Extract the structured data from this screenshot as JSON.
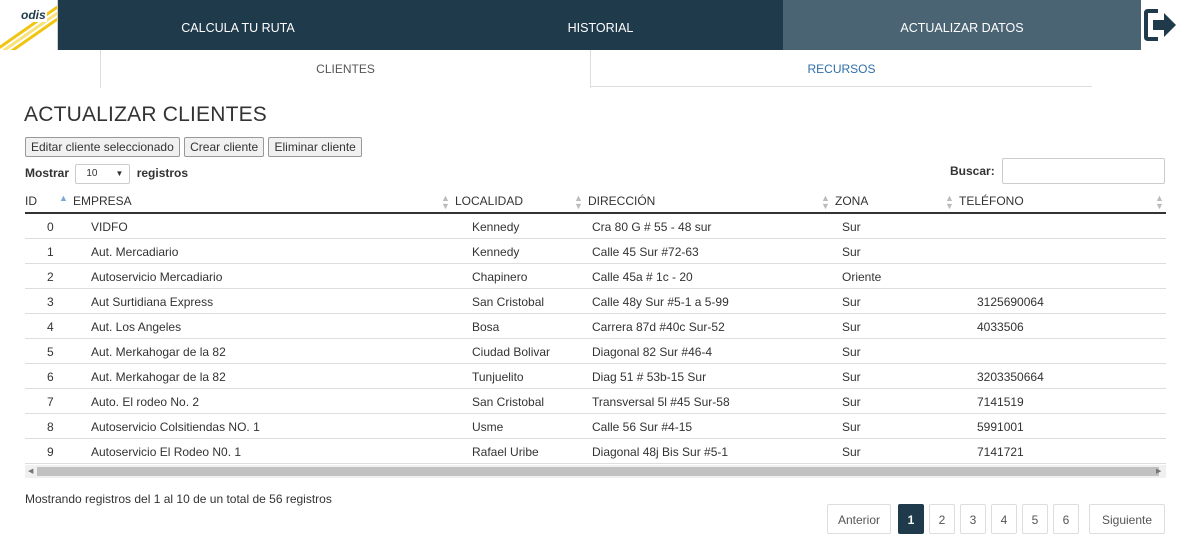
{
  "nav": {
    "logo_text": "odis",
    "items": [
      {
        "label": "CALCULA TU RUTA"
      },
      {
        "label": "HISTORIAL"
      },
      {
        "label": "ACTUALIZAR DATOS"
      }
    ],
    "exit_icon": "exit-icon"
  },
  "tabs": [
    {
      "label": "CLIENTES"
    },
    {
      "label": "RECURSOS"
    }
  ],
  "page_title": "ACTUALIZAR CLIENTES",
  "actions": {
    "edit_label": "Editar cliente seleccionado",
    "create_label": "Crear cliente",
    "delete_label": "Eliminar cliente"
  },
  "length_menu": {
    "prefix": "Mostrar",
    "value": "10",
    "suffix": "registros"
  },
  "search": {
    "label": "Buscar:",
    "value": ""
  },
  "table": {
    "columns": [
      "ID",
      "EMPRESA",
      "LOCALIDAD",
      "DIRECCIÓN",
      "ZONA",
      "TELÉFONO"
    ],
    "rows": [
      {
        "id": "0",
        "empresa": "VIDFO",
        "localidad": "Kennedy",
        "direccion": "Cra 80 G # 55 - 48 sur",
        "zona": "Sur",
        "telefono": ""
      },
      {
        "id": "1",
        "empresa": "Aut. Mercadiario",
        "localidad": "Kennedy",
        "direccion": "Calle 45 Sur #72-63",
        "zona": "Sur",
        "telefono": ""
      },
      {
        "id": "2",
        "empresa": "Autoservicio Mercadiario",
        "localidad": "Chapinero",
        "direccion": "Calle 45a # 1c - 20",
        "zona": "Oriente",
        "telefono": ""
      },
      {
        "id": "3",
        "empresa": "Aut Surtidiana Express",
        "localidad": "San Cristobal",
        "direccion": "Calle 48y Sur #5-1 a 5-99",
        "zona": "Sur",
        "telefono": "3125690064"
      },
      {
        "id": "4",
        "empresa": "Aut. Los Angeles",
        "localidad": "Bosa",
        "direccion": "Carrera 87d #40c Sur-52",
        "zona": "Sur",
        "telefono": "4033506"
      },
      {
        "id": "5",
        "empresa": "Aut. Merkahogar de la 82",
        "localidad": "Ciudad Bolivar",
        "direccion": "Diagonal 82 Sur #46-4",
        "zona": "Sur",
        "telefono": ""
      },
      {
        "id": "6",
        "empresa": "Aut. Merkahogar de la 82",
        "localidad": "Tunjuelito",
        "direccion": "Diag 51 # 53b-15 Sur",
        "zona": "Sur",
        "telefono": "3203350664"
      },
      {
        "id": "7",
        "empresa": "Auto. El rodeo No. 2",
        "localidad": "San Cristobal",
        "direccion": "Transversal 5l #45 Sur-58",
        "zona": "Sur",
        "telefono": "7141519"
      },
      {
        "id": "8",
        "empresa": "Autoservicio Colsitiendas NO. 1",
        "localidad": "Usme",
        "direccion": "Calle 56 Sur #4-15",
        "zona": "Sur",
        "telefono": "5991001"
      },
      {
        "id": "9",
        "empresa": "Autoservicio El Rodeo N0. 1",
        "localidad": "Rafael Uribe",
        "direccion": "Diagonal 48j Bis Sur #5-1",
        "zona": "Sur",
        "telefono": "7141721"
      }
    ]
  },
  "info_text": "Mostrando registros del 1 al 10 de un total de 56 registros",
  "pagination": {
    "prev_label": "Anterior",
    "pages": [
      "1",
      "2",
      "3",
      "4",
      "5",
      "6"
    ],
    "current_page": "1",
    "next_label": "Siguiente"
  },
  "colors": {
    "nav_bg": "#1f3a4a",
    "nav_active_bg": "#4a6474",
    "link": "#2f6fa8"
  }
}
